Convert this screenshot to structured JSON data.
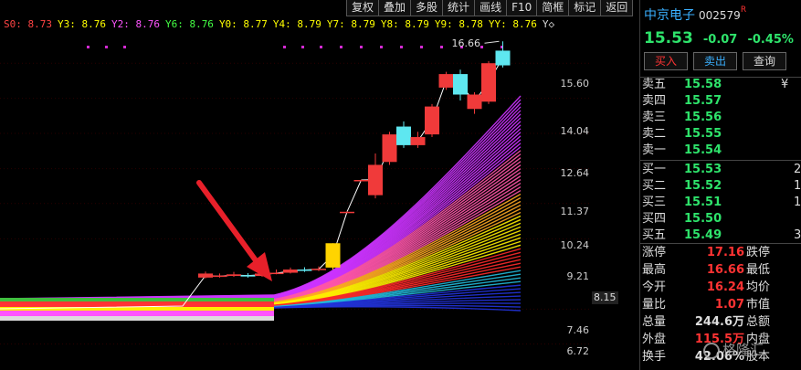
{
  "toolbar": [
    "复权",
    "叠加",
    "多股",
    "统计",
    "画线",
    "F10",
    "简框",
    "标记",
    "返回"
  ],
  "ma_legend": [
    {
      "label": "S0: 8.73",
      "color": "#ff4444"
    },
    {
      "label": "Y3: 8.76",
      "color": "#ffff00"
    },
    {
      "label": "Y2: 8.76",
      "color": "#ff55ff"
    },
    {
      "label": "Y6: 8.76",
      "color": "#44ff44"
    },
    {
      "label": "Y0: 8.77",
      "color": "#ffff00"
    },
    {
      "label": "Y4: 8.79",
      "color": "#ffff00"
    },
    {
      "label": "Y7: 8.79",
      "color": "#ffff00"
    },
    {
      "label": "Y8: 8.79",
      "color": "#ffff00"
    },
    {
      "label": "Y9: 8.78",
      "color": "#ffff00"
    },
    {
      "label": "YY: 8.76",
      "color": "#ffff00"
    }
  ],
  "legend_suffix": "Y◇",
  "axis": {
    "labels": [
      "15.60",
      "14.04",
      "12.64",
      "11.37",
      "10.24",
      "9.21",
      "8.15",
      "7.46",
      "6.72"
    ],
    "last_price": "8.15"
  },
  "chart_data": {
    "type": "candlestick",
    "y_axis_ticks": [
      15.6,
      14.04,
      12.64,
      11.37,
      10.24,
      9.21,
      7.46,
      6.72
    ],
    "ylim": [
      6.3,
      16.9
    ],
    "annotation": "16.66",
    "candles": [
      {
        "o": 8.2,
        "c": 8.3,
        "h": 8.35,
        "l": 8.18,
        "color": "red"
      },
      {
        "o": 8.22,
        "c": 8.25,
        "h": 8.3,
        "l": 8.2,
        "color": "red"
      },
      {
        "o": 8.24,
        "c": 8.28,
        "h": 8.34,
        "l": 8.22,
        "color": "red"
      },
      {
        "o": 8.26,
        "c": 8.24,
        "h": 8.31,
        "l": 8.2,
        "color": "cyan"
      },
      {
        "o": 8.24,
        "c": 8.3,
        "h": 8.36,
        "l": 8.22,
        "color": "red"
      },
      {
        "o": 8.3,
        "c": 8.32,
        "h": 8.4,
        "l": 8.28,
        "color": "red"
      },
      {
        "o": 8.32,
        "c": 8.4,
        "h": 8.45,
        "l": 8.3,
        "color": "red"
      },
      {
        "o": 8.4,
        "c": 8.38,
        "h": 8.46,
        "l": 8.34,
        "color": "cyan"
      },
      {
        "o": 8.4,
        "c": 8.42,
        "h": 8.48,
        "l": 8.36,
        "color": "red"
      },
      {
        "o": 8.45,
        "c": 9.09,
        "h": 9.09,
        "l": 8.4,
        "color": "yellow"
      },
      {
        "o": 9.99,
        "c": 9.99,
        "h": 10.0,
        "l": 9.98,
        "color": "red"
      },
      {
        "o": 10.99,
        "c": 10.99,
        "h": 11.0,
        "l": 10.98,
        "color": "red"
      },
      {
        "o": 10.5,
        "c": 11.5,
        "h": 11.9,
        "l": 10.4,
        "color": "red"
      },
      {
        "o": 11.6,
        "c": 12.6,
        "h": 12.7,
        "l": 11.5,
        "color": "red"
      },
      {
        "o": 12.9,
        "c": 12.2,
        "h": 13.1,
        "l": 12.1,
        "color": "cyan"
      },
      {
        "o": 12.2,
        "c": 12.5,
        "h": 12.7,
        "l": 12.1,
        "color": "red"
      },
      {
        "o": 12.6,
        "c": 13.7,
        "h": 13.8,
        "l": 12.5,
        "color": "red"
      },
      {
        "o": 14.5,
        "c": 15.1,
        "h": 15.2,
        "l": 14.4,
        "color": "red"
      },
      {
        "o": 15.1,
        "c": 14.2,
        "h": 15.3,
        "l": 13.95,
        "color": "cyan"
      },
      {
        "o": 13.6,
        "c": 14.2,
        "h": 14.3,
        "l": 13.4,
        "color": "red"
      },
      {
        "o": 13.9,
        "c": 15.6,
        "h": 15.7,
        "l": 13.8,
        "color": "red"
      },
      {
        "o": 15.5,
        "c": 16.2,
        "h": 16.66,
        "l": 15.4,
        "color": "cyan"
      }
    ]
  },
  "quote": {
    "name": "中京电子",
    "code": "002579",
    "flag": "R",
    "price": "15.53",
    "change": "-0.07",
    "change_pct": "-0.45%",
    "buttons": {
      "buy": "买入",
      "sell": "卖出",
      "query": "查询"
    }
  },
  "orderbook": {
    "asks": [
      {
        "label": "卖五",
        "price": "15.58",
        "extra": "¥"
      },
      {
        "label": "卖四",
        "price": "15.57",
        "extra": ""
      },
      {
        "label": "卖三",
        "price": "15.56",
        "extra": ""
      },
      {
        "label": "卖二",
        "price": "15.55",
        "extra": ""
      },
      {
        "label": "卖一",
        "price": "15.54",
        "extra": ""
      }
    ],
    "bids": [
      {
        "label": "买一",
        "price": "15.53",
        "extra": "2"
      },
      {
        "label": "买二",
        "price": "15.52",
        "extra": "1"
      },
      {
        "label": "买三",
        "price": "15.51",
        "extra": "1"
      },
      {
        "label": "买四",
        "price": "15.50",
        "extra": ""
      },
      {
        "label": "买五",
        "price": "15.49",
        "extra": "3"
      }
    ]
  },
  "stats": [
    {
      "l1": "涨停",
      "v1": "17.16",
      "c1": "red",
      "l2": "跌停"
    },
    {
      "l1": "最高",
      "v1": "16.66",
      "c1": "red",
      "l2": "最低"
    },
    {
      "l1": "今开",
      "v1": "16.24",
      "c1": "red",
      "l2": "均价"
    },
    {
      "l1": "量比",
      "v1": "1.07",
      "c1": "red",
      "l2": "市值"
    },
    {
      "l1": "总量",
      "v1": "244.6万",
      "c1": "white",
      "l2": "总额"
    },
    {
      "l1": "外盘",
      "v1": "115.5万",
      "c1": "red",
      "l2": "内盘"
    },
    {
      "l1": "换手",
      "v1": "42.06%",
      "c1": "white",
      "l2": "股本"
    }
  ],
  "watermark": "格隆汇"
}
